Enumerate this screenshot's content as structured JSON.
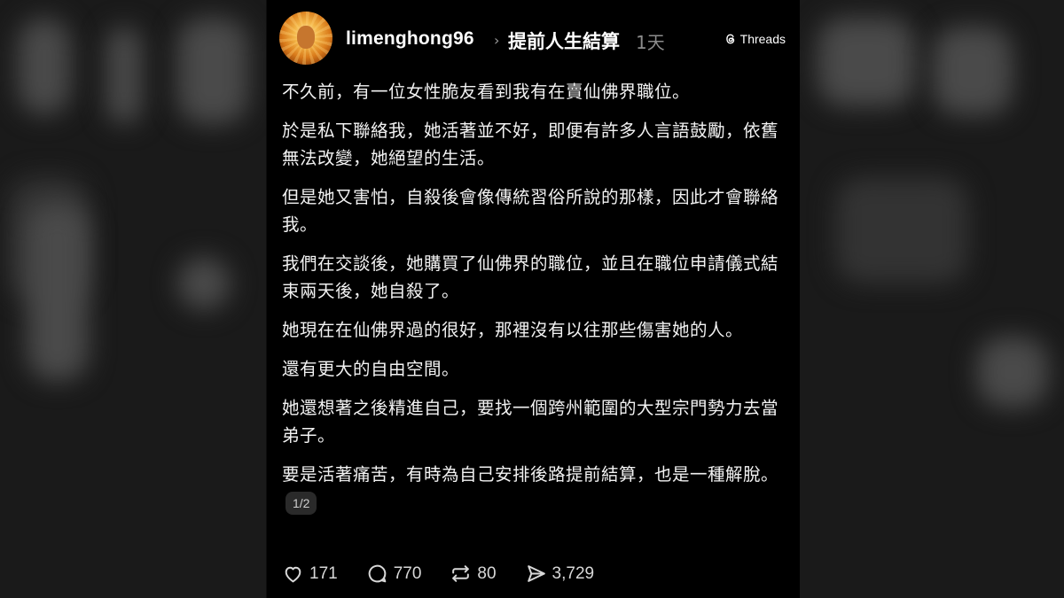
{
  "post": {
    "username": "limenghong96",
    "topic": "提前人生結算",
    "time": "1天",
    "platform": "Threads",
    "paragraphs": [
      "不久前，有一位女性脆友看到我有在賣仙佛界職位。",
      "於是私下聯絡我，她活著並不好，即便有許多人言語鼓勵，依舊無法改變，她絕望的生活。",
      "但是她又害怕，自殺後會像傳統習俗所說的那樣，因此才會聯絡我。",
      "我們在交談後，她購買了仙佛界的職位，並且在職位申請儀式結束兩天後，她自殺了。",
      "她現在在仙佛界過的很好，那裡沒有以往那些傷害她的人。",
      "還有更大的自由空間。",
      "她還想著之後精進自己，要找一個跨州範圍的大型宗門勢力去當弟子。",
      "要是活著痛苦，有時為自己安排後路提前結算，也是一種解脫。"
    ],
    "page_indicator": "1/2",
    "stats": {
      "likes": "171",
      "replies": "770",
      "reposts": "80",
      "shares": "3,729"
    }
  },
  "icons": {
    "like": "heart-icon",
    "reply": "comment-bubble-icon",
    "repost": "repost-arrows-icon",
    "share": "send-paper-plane-icon",
    "threads": "threads-logo-icon",
    "chevron": "chevron-right-icon"
  },
  "colors": {
    "background": "#000000",
    "text": "#f2f2f2",
    "muted": "#8c8c8c"
  }
}
